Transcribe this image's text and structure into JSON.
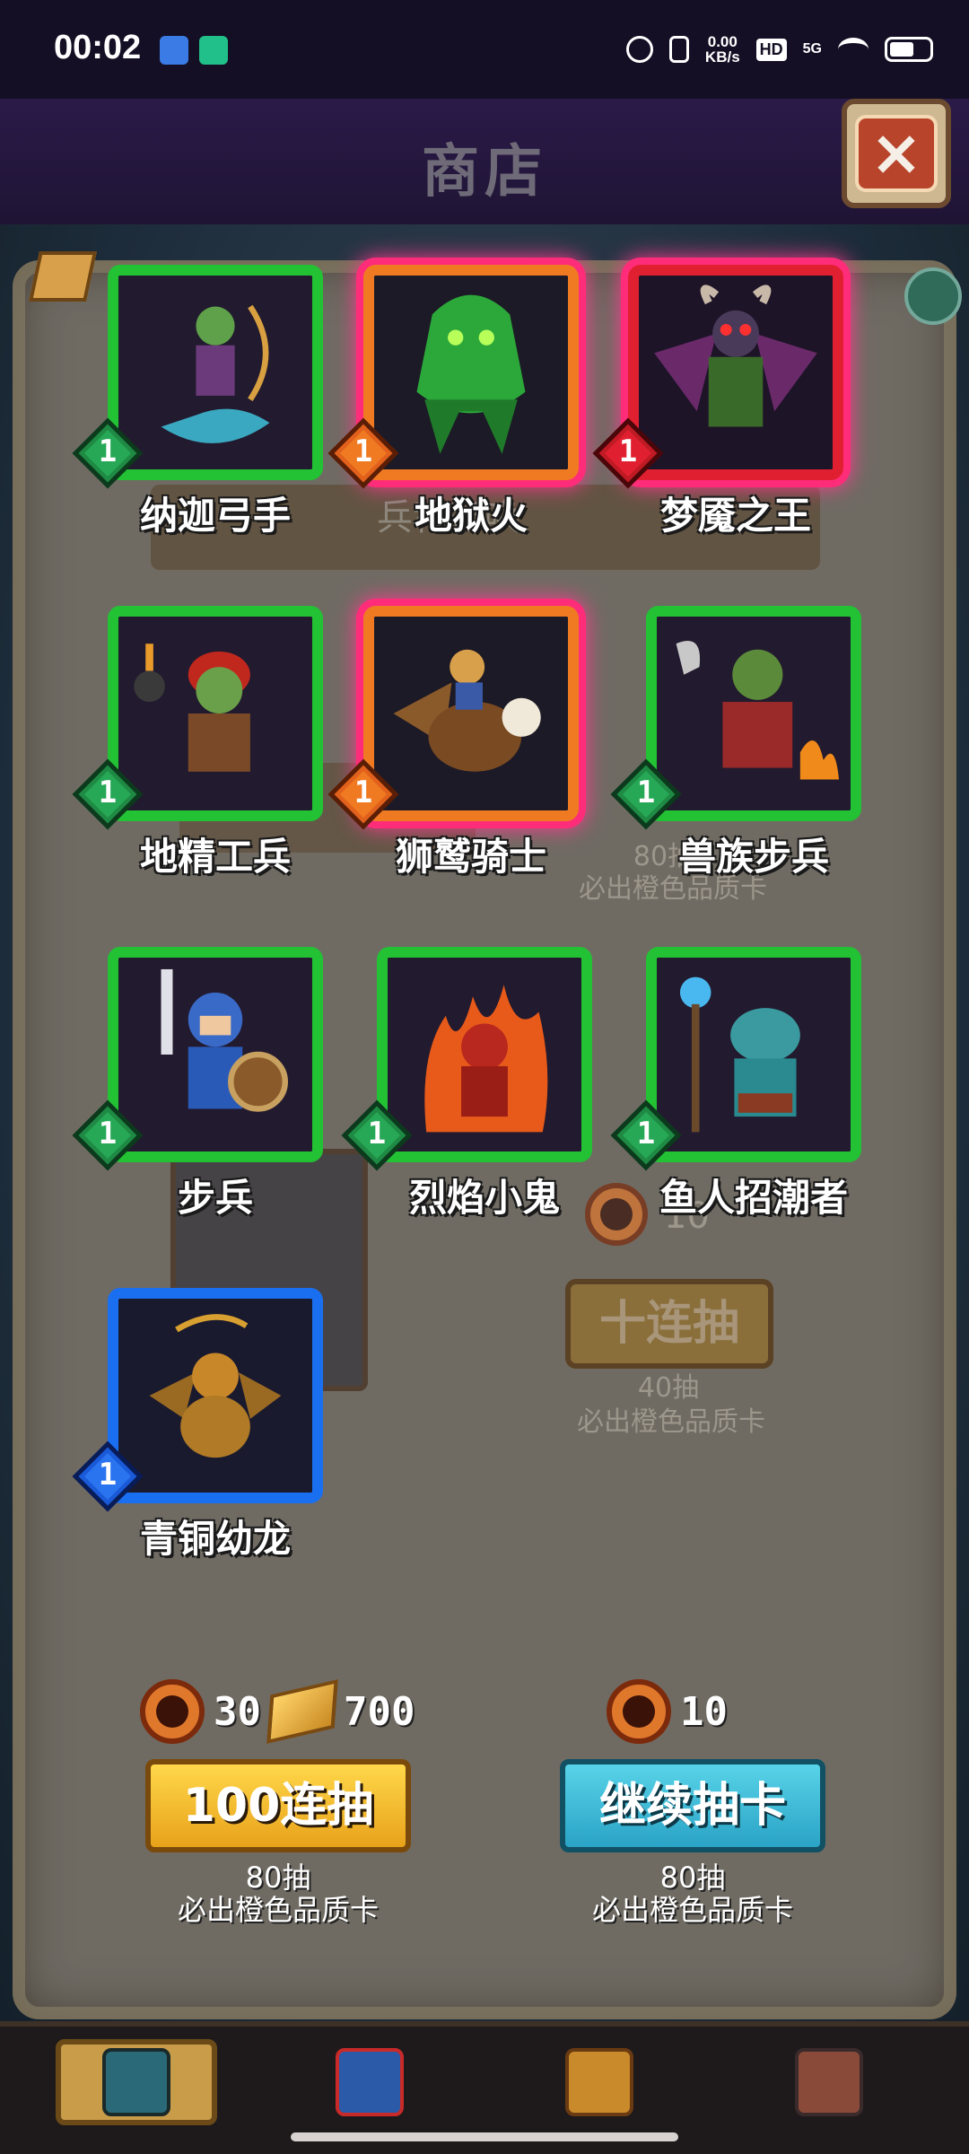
{
  "status_bar": {
    "time": "00:02",
    "net_speed_value": "0.00",
    "net_speed_unit": "KB/s",
    "hd": "HD",
    "signal": "5G"
  },
  "header": {
    "title": "商店",
    "close_icon": "×"
  },
  "background_text": {
    "banner_partial": "兵种召唤",
    "note1_count": "80抽",
    "note1_text": "必出橙色品质卡",
    "ghost_coin_count": "10",
    "ten_pull_label": "十连抽",
    "note2_count": "40抽",
    "note2_text": "必出橙色品质卡"
  },
  "cards": [
    {
      "name": "纳迦弓手",
      "level": "1",
      "rarity": "green"
    },
    {
      "name": "地狱火",
      "level": "1",
      "rarity": "orange"
    },
    {
      "name": "梦魇之王",
      "level": "1",
      "rarity": "red"
    },
    {
      "name": "地精工兵",
      "level": "1",
      "rarity": "green"
    },
    {
      "name": "狮鹫骑士",
      "level": "1",
      "rarity": "orange"
    },
    {
      "name": "兽族步兵",
      "level": "1",
      "rarity": "green"
    },
    {
      "name": "步兵",
      "level": "1",
      "rarity": "green"
    },
    {
      "name": "烈焰小鬼",
      "level": "1",
      "rarity": "green"
    },
    {
      "name": "鱼人招潮者",
      "level": "1",
      "rarity": "green"
    },
    {
      "name": "青铜幼龙",
      "level": "1",
      "rarity": "blue"
    }
  ],
  "pull_hundred": {
    "coin_cost": "30",
    "gold_cost": "700",
    "label": "100连抽",
    "note_count": "80抽",
    "note_text": "必出橙色品质卡"
  },
  "continue_draw": {
    "coin_cost": "10",
    "label": "继续抽卡",
    "note_count": "80抽",
    "note_text": "必出橙色品质卡"
  },
  "nav": [
    {
      "icon": "card-deck-icon",
      "active": true
    },
    {
      "icon": "gift-box-icon",
      "active": false
    },
    {
      "icon": "treasure-chest-icon",
      "active": false
    },
    {
      "icon": "barracks-house-icon",
      "active": false
    }
  ],
  "colors": {
    "green_frame": "#22c234",
    "orange_frame": "#f07a22",
    "red_frame": "#e02030",
    "blue_frame": "#1a6ff0",
    "glow_pink": "#ff2c7a",
    "yellow_button": "#ffd74a",
    "teal_button": "#58d3e8"
  }
}
